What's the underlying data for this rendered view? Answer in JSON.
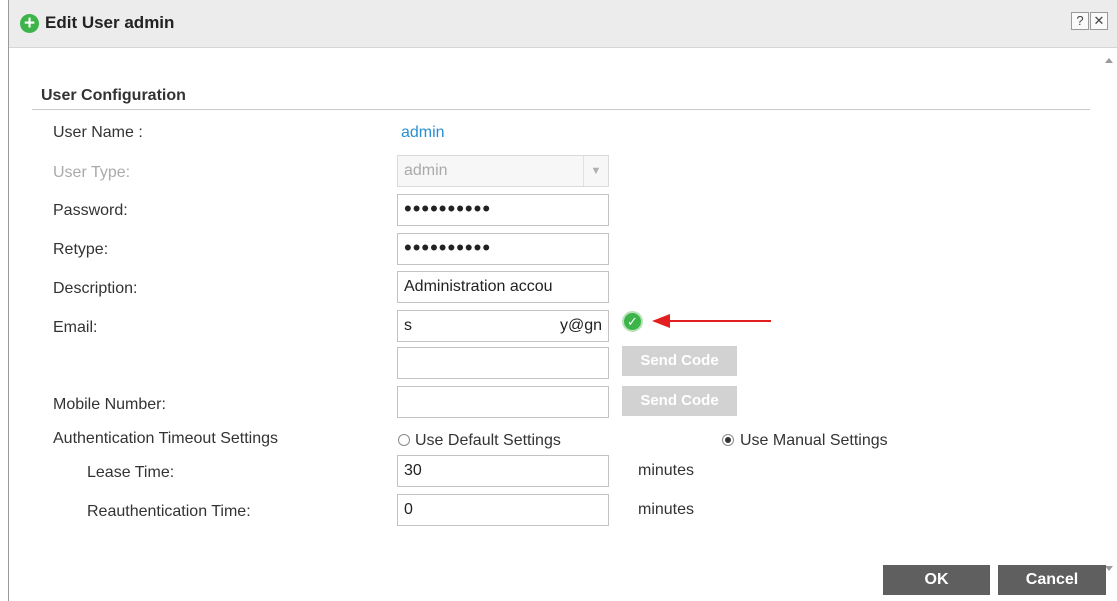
{
  "dialog": {
    "title": "Edit User admin",
    "title_icon": "plus-circle-icon",
    "help_glyph": "?",
    "close_glyph": "✕"
  },
  "section": {
    "title": "User Configuration"
  },
  "fields": {
    "user_name": {
      "label": "User Name :",
      "value": "admin"
    },
    "user_type": {
      "label": "User Type:",
      "value": "admin"
    },
    "password": {
      "label": "Password:",
      "value": "••••••••••"
    },
    "retype": {
      "label": "Retype:",
      "value": "••••••••••"
    },
    "description": {
      "label": "Description:",
      "value": "Administration accou"
    },
    "email": {
      "label": "Email:",
      "value_start": "s",
      "value_end": "y@gn",
      "status_icon": "check-circle-icon"
    },
    "email_code": {
      "value": "",
      "button": "Send Code"
    },
    "mobile": {
      "label": "Mobile Number:",
      "value": "",
      "button": "Send Code"
    }
  },
  "auth_timeout": {
    "label": "Authentication Timeout Settings",
    "option_default": "Use Default Settings",
    "option_manual": "Use Manual Settings",
    "selected": "manual",
    "lease_time": {
      "label": "Lease Time:",
      "value": "30",
      "unit": "minutes"
    },
    "reauth_time": {
      "label": "Reauthentication Time:",
      "value": "0",
      "unit": "minutes"
    }
  },
  "footer": {
    "ok": "OK",
    "cancel": "Cancel"
  },
  "colors": {
    "accent_green": "#3db44a",
    "link_blue": "#2a8fd0",
    "annotation_red": "#e21e1e",
    "button_dark": "#5f5f5f"
  }
}
